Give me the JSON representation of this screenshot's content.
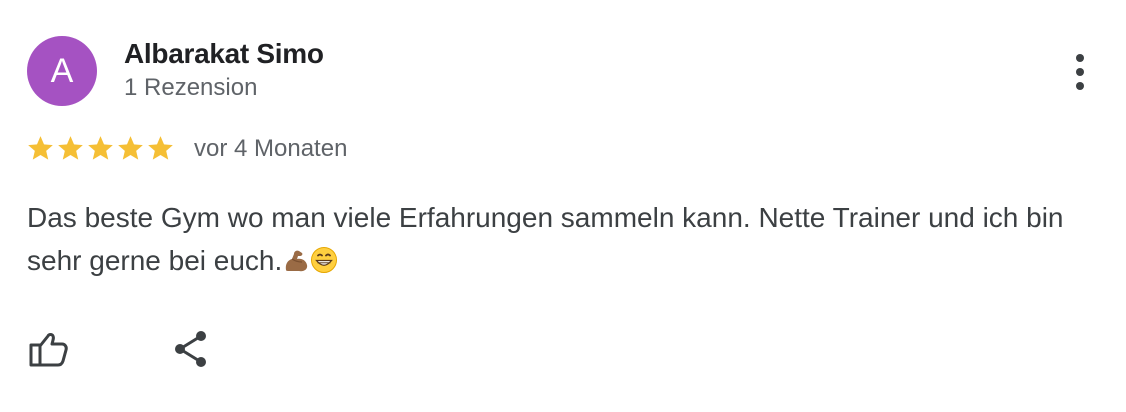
{
  "review": {
    "avatar_letter": "A",
    "avatar_color": "#a552c2",
    "author_name": "Albarakat Simo",
    "author_meta": "1 Rezension",
    "rating": 5,
    "rating_max": 5,
    "star_color": "#f5bf35",
    "time_ago": "vor 4 Monaten",
    "text": "Das beste Gym wo man viele Erfahrungen sammeln kann. Nette Trainer und ich bin sehr gerne bei euch.",
    "emojis": [
      "flexed-biceps-emoji",
      "grinning-face-emoji"
    ]
  },
  "actions": {
    "more_icon": "more-vert-icon",
    "like_icon": "thumb-up-icon",
    "share_icon": "share-icon"
  }
}
